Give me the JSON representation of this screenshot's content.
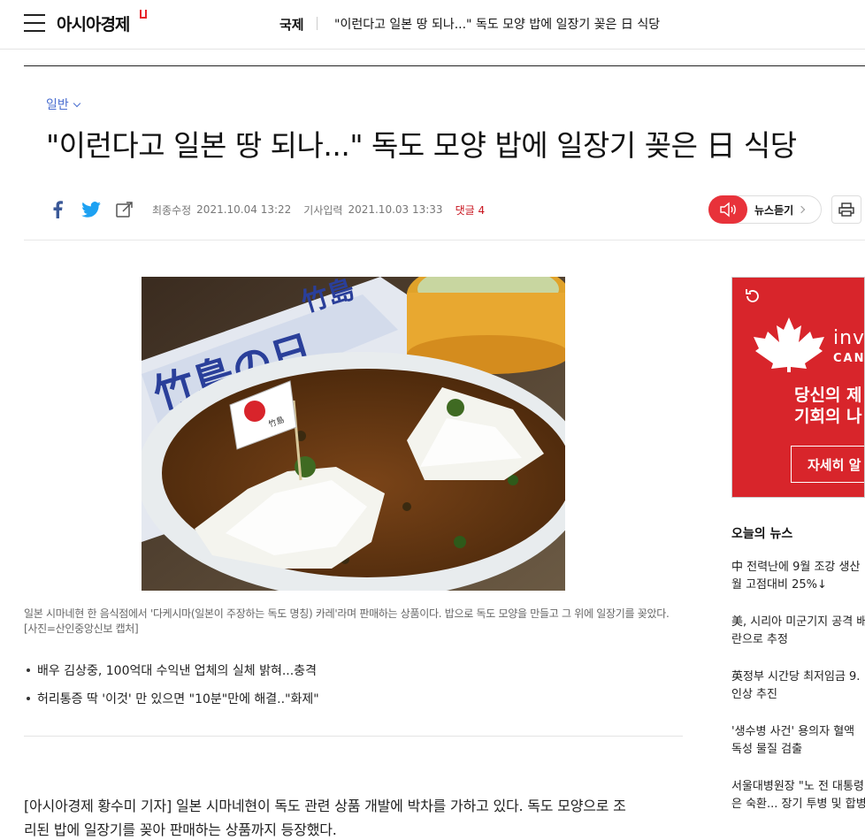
{
  "header": {
    "logo": "아시아경제",
    "section": "국제",
    "headline": "\"이런다고 일본 땅 되나...\" 독도 모양 밥에 일장기 꽂은 日 식당"
  },
  "article": {
    "category": "일반",
    "title": "\"이런다고 일본 땅 되나...\" 독도 모양 밥에 일장기 꽂은 日 식당",
    "meta": {
      "modified_label": "최종수정",
      "modified_date": "2021.10.04 13:22",
      "published_label": "기사입력",
      "published_date": "2021.10.03 13:33",
      "comments": "댓글 4"
    },
    "listen_label": "뉴스듣기",
    "photo_labels": {
      "sign_text": "竹島の日",
      "sign_text_2": "竹島",
      "flag_text": "竹島"
    },
    "caption": "일본 시마네현 한 음식점에서 '다케시마(일본이 주장하는 독도 명칭) 카레'라며 판매하는 상품이다. 밥으로 독도 모양을 만들고 그 위에 일장기를 꽂았다. [사진=산인중앙신보 캡처]",
    "related": [
      "배우 김상중, 100억대 수익낸 업체의 실체 밝혀...충격",
      "허리통증 딱 '이것' 만 있으면 \"10분\"만에 해결..\"화제\""
    ],
    "body_line1": "[아시아경제 황수미 기자] 일본 시마네현이 독도 관련 상품 개발에 박차를 가하고 있다. 독도 모양으로 조",
    "body_line2": "리된 밥에 일장기를 꽂아 판매하는 상품까지 등장했다."
  },
  "sidebar": {
    "ad": {
      "brand": "inve",
      "brand_sub": "CAN",
      "line1": "당신의 제",
      "line2": "기회의 나",
      "button": "자세히 알"
    },
    "today_title": "오늘의 뉴스",
    "news": [
      {
        "l1": "中 전력난에 9월 조강 생산",
        "l2": "월 고점대비 25%↓"
      },
      {
        "l1": "美, 시리아 미군기지 공격 배",
        "l2": "란으로 추정"
      },
      {
        "l1": "英정부 시간당 최저임금 9.",
        "l2": "인상 추진"
      },
      {
        "l1": "'생수병 사건' 용의자 혈액",
        "l2": "독성 물질 검출"
      },
      {
        "l1": "서울대병원장 \"노 전 대통령",
        "l2": "은 숙환... 장기 투병 및 합병"
      }
    ]
  },
  "colors": {
    "accent_red": "#e8242b",
    "category_blue": "#4a6ed0",
    "comment_red": "#c8141e"
  }
}
